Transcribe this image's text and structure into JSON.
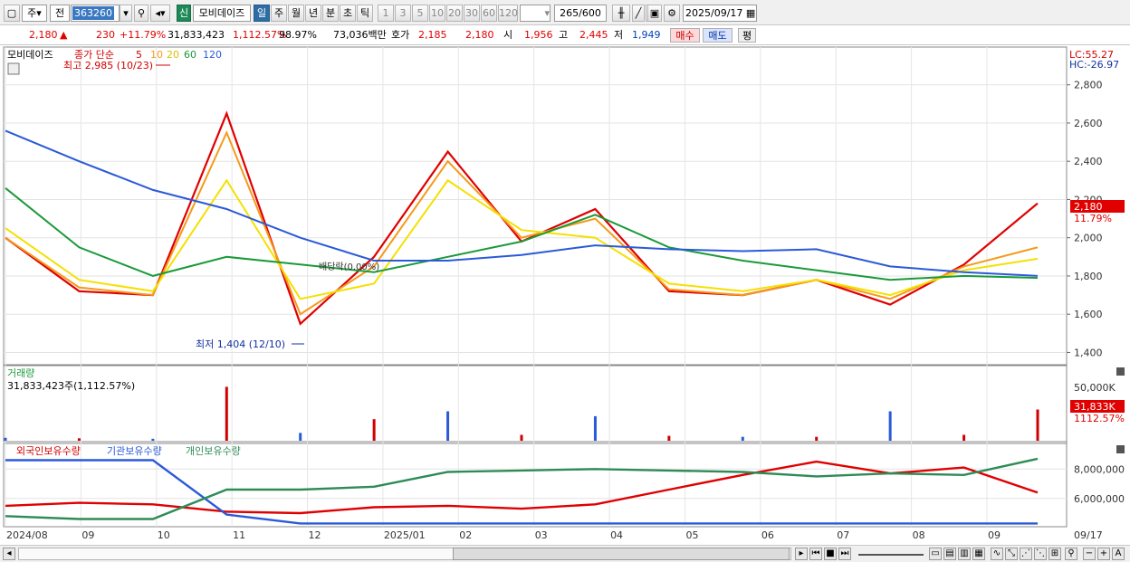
{
  "toolbar": {
    "market": "주",
    "scope": "전",
    "code": "363260",
    "badge_new": "신",
    "stock_name": "모비데이즈",
    "periods": [
      "일",
      "주",
      "월",
      "년",
      "분",
      "초",
      "틱"
    ],
    "active_period": "일",
    "intervals": [
      "1",
      "3",
      "5",
      "10",
      "20",
      "30",
      "60",
      "120"
    ],
    "count": "265",
    "count_total": "/600",
    "date": "2025/09/17"
  },
  "quote": {
    "price": "2,180",
    "change": "230",
    "change_pct": "+11.79%",
    "volume": "31,833,423",
    "vol_ratio": "1,112.57%",
    "turnover_ratio": "98.97%",
    "amount": "73,036백만",
    "ask_label": "호가",
    "ask": "2,185",
    "bid": "2,180",
    "open_label": "시",
    "open": "1,956",
    "high_label": "고",
    "high": "2,445",
    "low_label": "저",
    "low": "1,949",
    "buy_label": "매수",
    "sell_label": "매도",
    "avg_label": "평"
  },
  "price_panel": {
    "title": "모비데이즈",
    "ma_label": "종가 단순",
    "ma_periods": [
      "5",
      "10",
      "20",
      "60",
      "120"
    ],
    "ma_colors": [
      "#e00000",
      "#f59a1a",
      "#f5e000",
      "#1a9a3a",
      "#2a5ad8"
    ],
    "high_note": "최고 2,985 (10/23)",
    "low_note": "최저 1,404 (12/10)",
    "dividend_note": "배당락(0.00%)",
    "lc": "LC:55.27",
    "hc": "HC:-26.97",
    "last_price": "2,180",
    "last_pct": "11.79%",
    "y_ticks": [
      "2,800",
      "2,600",
      "2,400",
      "2,200",
      "2,000",
      "1,800",
      "1,600",
      "1,400"
    ]
  },
  "volume_panel": {
    "title": "거래량",
    "info": "31,833,423주(1,112.57%)",
    "y_tick": "50,000K",
    "last_vol": "31,833K",
    "last_pct": "1112.57%"
  },
  "holding_panel": {
    "legend": [
      "외국인보유수량",
      "기관보유수량",
      "개인보유수량"
    ],
    "colors": [
      "#e00000",
      "#2a5ad8",
      "#2e8b57"
    ],
    "y_ticks": [
      "8,000,000",
      "6,000,000"
    ]
  },
  "x_axis": {
    "labels": [
      "2024/08",
      "09",
      "10",
      "11",
      "12",
      "2025/01",
      "02",
      "03",
      "04",
      "05",
      "06",
      "07",
      "08",
      "09"
    ],
    "end_label": "09/17"
  },
  "chart_data": {
    "type": "line",
    "title": "모비데이즈",
    "x": [
      "2024/08",
      "2024/09",
      "2024/10",
      "2024/11",
      "2024/12",
      "2025/01",
      "2025/02",
      "2025/03",
      "2025/04",
      "2025/05",
      "2025/06",
      "2025/07",
      "2025/08",
      "2025/09",
      "2025/09/17"
    ],
    "ylim": [
      1350,
      2950
    ],
    "series": [
      {
        "name": "5",
        "values": [
          2000,
          1720,
          1700,
          2650,
          1550,
          1900,
          2450,
          1980,
          2150,
          1720,
          1700,
          1780,
          1650,
          1860,
          2180
        ]
      },
      {
        "name": "10",
        "values": [
          2000,
          1740,
          1700,
          2550,
          1600,
          1850,
          2400,
          2000,
          2100,
          1730,
          1700,
          1780,
          1680,
          1850,
          1950
        ]
      },
      {
        "name": "20",
        "values": [
          2050,
          1780,
          1720,
          2300,
          1680,
          1760,
          2300,
          2040,
          2000,
          1760,
          1720,
          1780,
          1700,
          1830,
          1890
        ]
      },
      {
        "name": "60",
        "values": [
          2260,
          1950,
          1800,
          1900,
          1860,
          1820,
          1900,
          1980,
          2120,
          1950,
          1880,
          1830,
          1780,
          1800,
          1790
        ]
      },
      {
        "name": "120",
        "values": [
          2560,
          2400,
          2250,
          2150,
          2000,
          1880,
          1880,
          1910,
          1960,
          1940,
          1930,
          1940,
          1850,
          1820,
          1800
        ]
      }
    ],
    "price_high": {
      "value": 2985,
      "date": "10/23"
    },
    "price_low": {
      "value": 1404,
      "date": "12/10"
    },
    "last": {
      "price": 2180,
      "change_pct": 11.79
    },
    "volume": {
      "last": 31833423,
      "values_k": [
        3000,
        2500,
        2000,
        55000,
        8000,
        22000,
        30000,
        6000,
        25000,
        5000,
        4000,
        4000,
        30000,
        6000,
        31833
      ]
    },
    "holdings": {
      "series": [
        {
          "name": "외국인보유수량",
          "values": [
            5500000,
            5700000,
            5600000,
            5100000,
            5000000,
            5400000,
            5500000,
            5300000,
            5600000,
            6600000,
            7600000,
            8500000,
            7700000,
            8100000,
            6400000
          ]
        },
        {
          "name": "기관보유수량",
          "values": [
            8600000,
            8600000,
            8600000,
            4900000,
            4300000,
            4300000,
            4300000,
            4300000,
            4300000,
            4300000,
            4300000,
            4300000,
            4300000,
            4300000,
            4300000
          ]
        },
        {
          "name": "개인보유수량",
          "values": [
            4800000,
            4600000,
            4600000,
            6600000,
            6600000,
            6800000,
            7800000,
            7900000,
            8000000,
            7900000,
            7800000,
            7500000,
            7700000,
            7600000,
            8700000
          ]
        }
      ],
      "ylim": [
        4200000,
        9000000
      ]
    }
  }
}
